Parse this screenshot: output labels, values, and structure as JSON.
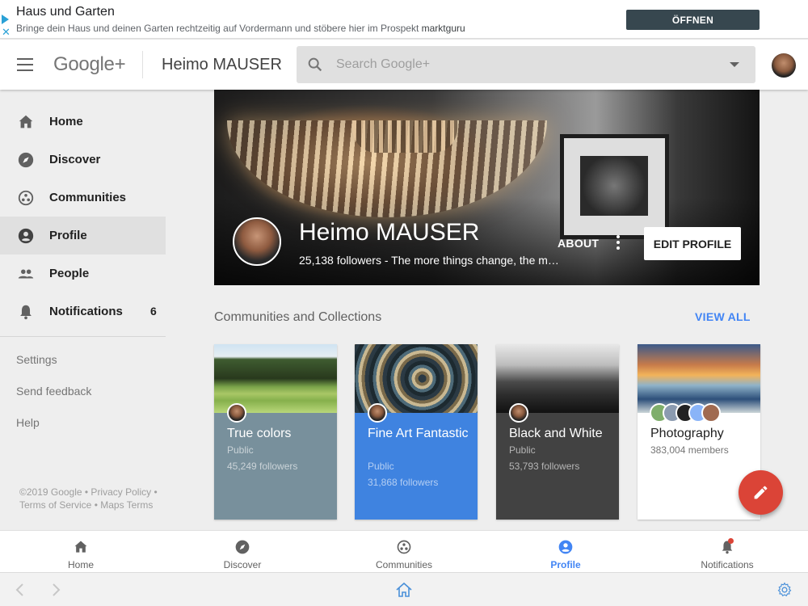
{
  "ad": {
    "title": "Haus und Garten",
    "text": "Bringe dein Haus und deinen Garten rechtzeitig auf Vordermann und stöbere hier im Prospekt",
    "brand": "marktguru",
    "button": "ÖFFNEN"
  },
  "appbar": {
    "logo": "Google+",
    "title": "Heimo MAUSER",
    "search_placeholder": "Search Google+"
  },
  "sidebar": {
    "items": [
      {
        "label": "Home",
        "icon": "home-icon"
      },
      {
        "label": "Discover",
        "icon": "compass-icon"
      },
      {
        "label": "Communities",
        "icon": "communities-icon"
      },
      {
        "label": "Profile",
        "icon": "account-circle-icon"
      },
      {
        "label": "People",
        "icon": "people-icon"
      },
      {
        "label": "Notifications",
        "icon": "bell-icon",
        "count": "6"
      }
    ],
    "links": [
      "Settings",
      "Send feedback",
      "Help"
    ],
    "footer": "©2019 Google • Privacy Policy • Terms of Service • Maps Terms"
  },
  "profile": {
    "name": "Heimo MAUSER",
    "subtitle": "25,138 followers - The more things change, the m…",
    "about": "ABOUT",
    "edit": "EDIT PROFILE"
  },
  "section": {
    "title": "Communities and Collections",
    "view_all": "VIEW ALL"
  },
  "cards": [
    {
      "title": "True colors",
      "meta1": "Public",
      "meta2": "45,249 followers",
      "color": "#78909c"
    },
    {
      "title": "Fine Art Fantastic",
      "meta1": "Public",
      "meta2": "31,868 followers",
      "color": "#3f83e0"
    },
    {
      "title": "Black and White",
      "meta1": "Public",
      "meta2": "53,793 followers",
      "color": "#424242"
    },
    {
      "title": "Photography",
      "meta1": "383,004 members",
      "color": "#ffffff"
    }
  ],
  "bottom_nav": [
    {
      "label": "Home",
      "icon": "home-icon"
    },
    {
      "label": "Discover",
      "icon": "compass-icon"
    },
    {
      "label": "Communities",
      "icon": "communities-icon"
    },
    {
      "label": "Profile",
      "icon": "account-circle-icon"
    },
    {
      "label": "Notifications",
      "icon": "bell-icon"
    }
  ],
  "colors": {
    "accent": "#4285f4",
    "fab": "#db4437"
  }
}
